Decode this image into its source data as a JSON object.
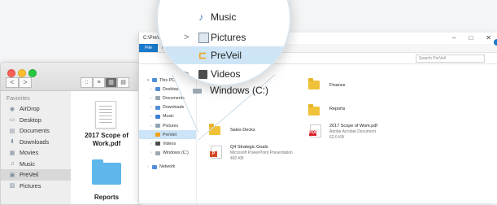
{
  "mac_finder": {
    "nav": {
      "back": "<",
      "forward": ">"
    },
    "view_buttons": [
      "::",
      "≡",
      "▥",
      "▤"
    ],
    "sidebar": {
      "header": "Favorites",
      "items": [
        {
          "label": "AirDrop",
          "icon": "airdrop-icon"
        },
        {
          "label": "Desktop",
          "icon": "desktop-icon"
        },
        {
          "label": "Documents",
          "icon": "documents-icon"
        },
        {
          "label": "Downloads",
          "icon": "downloads-icon"
        },
        {
          "label": "Movies",
          "icon": "movies-icon"
        },
        {
          "label": "Music",
          "icon": "music-icon"
        },
        {
          "label": "PreVeil",
          "icon": "preveil-icon",
          "selected": true
        },
        {
          "label": "Pictures",
          "icon": "pictures-icon"
        }
      ]
    },
    "files": [
      {
        "label_line1": "2017 Scope of",
        "label_line2": "Work.pdf",
        "icon": "pdf-icon"
      },
      {
        "label_line1": "Reports",
        "label_line2": "",
        "icon": "folder-icon"
      }
    ]
  },
  "windows_explorer": {
    "title_path": "C:\\PreVeil",
    "ribbon": {
      "file_tab": "File",
      "home_tab": "Ho"
    },
    "window_controls": [
      "–",
      "□",
      "✕"
    ],
    "search_placeholder": "Search PreVeil",
    "tree": [
      {
        "label": "This PC",
        "color": "#4f8fd6"
      },
      {
        "label": "Desktop",
        "color": "#4f8fd6"
      },
      {
        "label": "Documents",
        "color": "#9aa6b2"
      },
      {
        "label": "Downloads",
        "color": "#4f8fd6"
      },
      {
        "label": "Music",
        "color": "#3a7fd1"
      },
      {
        "label": "Pictures",
        "color": "#8fa3b6"
      },
      {
        "label": "PreVeil",
        "color": "#f0a21a",
        "selected": true
      },
      {
        "label": "Videos",
        "color": "#4d4d4d"
      },
      {
        "label": "Windows (C:)",
        "color": "#9aa6b2"
      },
      {
        "label": "Network",
        "color": "#4f8fd6"
      }
    ],
    "content": {
      "finance": {
        "name": "Finance"
      },
      "reports": {
        "name": "Reports"
      },
      "sales_decks": {
        "name": "Sales Decks"
      },
      "scope_pdf": {
        "name": "2017 Scope of Work.pdf",
        "type": "Adobe Acrobat Document",
        "size": "62.0 KB"
      },
      "q4_goals": {
        "name": "Q4 Strategic Goals",
        "type": "Microsoft PowerPoint Presentation",
        "size": "492 KB"
      }
    }
  },
  "magnifier": {
    "rows": [
      {
        "label": "Music",
        "icon": "music-icon",
        "chevron": ""
      },
      {
        "label": "Pictures",
        "icon": "pictures-icon",
        "chevron": ">"
      },
      {
        "label": "PreVeil",
        "icon": "preveil-icon",
        "chevron": "",
        "selected": true
      },
      {
        "label": "Videos",
        "icon": "videos-icon",
        "chevron": ">"
      },
      {
        "label": "Windows (C:)",
        "icon": "drive-icon",
        "chevron": ""
      }
    ]
  }
}
